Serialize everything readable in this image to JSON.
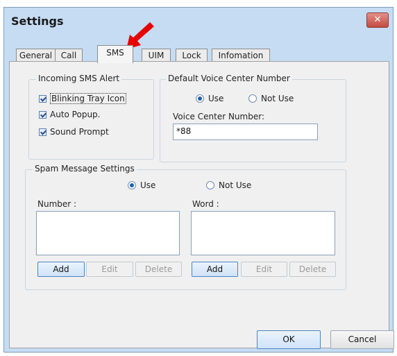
{
  "window": {
    "title": "Settings",
    "close_glyph": "✕"
  },
  "tabs": [
    {
      "label": "General"
    },
    {
      "label": "Call"
    },
    {
      "label": "SMS"
    },
    {
      "label": "UIM"
    },
    {
      "label": "Lock"
    },
    {
      "label": "Infomation"
    }
  ],
  "incoming_sms_alert": {
    "title": "Incoming SMS Alert",
    "options": [
      {
        "label": "Blinking Tray Icon",
        "checked": true
      },
      {
        "label": "Auto Popup.",
        "checked": true
      },
      {
        "label": "Sound Prompt",
        "checked": true
      }
    ]
  },
  "default_voice_center": {
    "title": "Default Voice Center Number",
    "use_label": "Use",
    "not_use_label": "Not Use",
    "selected": "Use",
    "number_label": "Voice Center Number:",
    "number_value": "*88"
  },
  "spam": {
    "title": "Spam Message Settings",
    "use_label": "Use",
    "not_use_label": "Not Use",
    "selected": "Use",
    "number_label": "Number :",
    "word_label": "Word :",
    "add_label": "Add",
    "edit_label": "Edit",
    "delete_label": "Delete"
  },
  "footer": {
    "ok_label": "OK",
    "cancel_label": "Cancel"
  },
  "annotation_color": "#e60000"
}
